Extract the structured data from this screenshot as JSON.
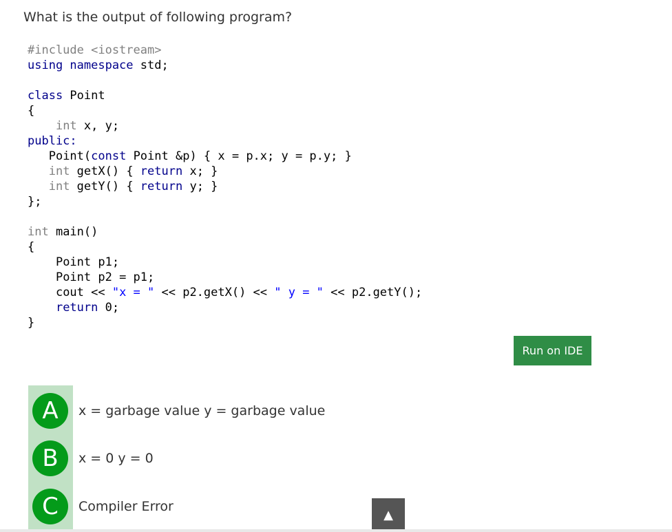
{
  "question": "What is the output of following program?",
  "code": {
    "l1": "#include <iostream>",
    "l2_kw": "using namespace",
    "l2_rest": " std;",
    "l4_kw": "class",
    "l4_rest": " Point",
    "l5": "{",
    "l6_ty": "int",
    "l6_rest": " x, y;",
    "l7": "public:",
    "l8_a": "Point(",
    "l8_kw": "const",
    "l8_b": " Point &p) { x = p.x; y = p.y; }",
    "l9_ty": "int",
    "l9_a": " getX() { ",
    "l9_kw": "return",
    "l9_b": " x; }",
    "l10_ty": "int",
    "l10_a": " getY() { ",
    "l10_kw": "return",
    "l10_b": " y; }",
    "l11": "};",
    "l13_ty": "int",
    "l13_rest": " main()",
    "l14": "{",
    "l15": "Point p1;",
    "l16": "Point p2 = p1;",
    "l17_a": "cout << ",
    "l17_s1": "\"x = \"",
    "l17_b": " << p2.getX() << ",
    "l17_s2": "\" y = \"",
    "l17_c": " << p2.getY();",
    "l18_kw": "return",
    "l18_rest": " 0;",
    "l19": "}"
  },
  "run_button": "Run on IDE",
  "options": [
    {
      "letter": "A",
      "text": "x = garbage value y = garbage value"
    },
    {
      "letter": "B",
      "text": "x = 0 y = 0"
    },
    {
      "letter": "C",
      "text": "Compiler Error"
    }
  ],
  "scroll_top_icon": "▲",
  "colors": {
    "button_bg": "#2f8d46",
    "badge_bg": "#049b1a",
    "option_strip": "#c1e1c5"
  }
}
